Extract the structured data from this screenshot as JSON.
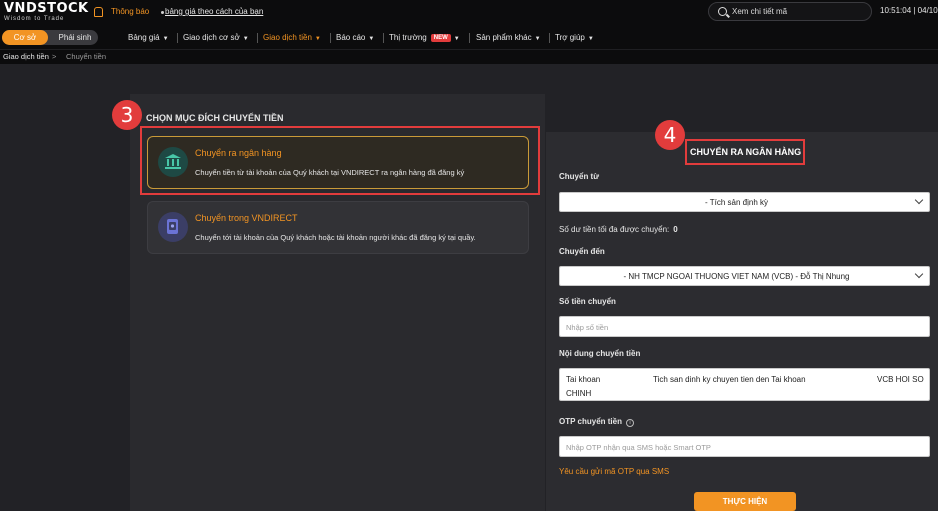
{
  "topbar": {
    "logo_main": "VNDSTOCK",
    "logo_sub": "Wisdom to Trade",
    "notification_label": "Thông báo",
    "ticker_text": "bảng giá theo cách của bạn",
    "search_placeholder": "Xem chi tiết mã",
    "clock": "10:51:04 | 04/10"
  },
  "market_switch": {
    "primary": "Cơ sở",
    "secondary": "Phái sinh"
  },
  "nav": {
    "items": [
      {
        "label": "Bảng giá",
        "active": false
      },
      {
        "label": "Giao dịch cơ sở",
        "active": false
      },
      {
        "label": "Giao dịch tiền",
        "active": true
      },
      {
        "label": "Báo cáo",
        "active": false
      },
      {
        "label": "Thị trường",
        "active": false,
        "badge": "NEW"
      },
      {
        "label": "Sản phẩm khác",
        "active": false
      },
      {
        "label": "Trợ giúp",
        "active": false
      }
    ]
  },
  "breadcrumb": {
    "root": "Giao dịch tiền",
    "separator": ">",
    "current": "Chuyển tiền"
  },
  "annotations": {
    "step_left": "3",
    "step_right": "4",
    "color": "#e23c3c"
  },
  "purpose": {
    "title": "CHỌN MỤC ĐÍCH CHUYỂN TIỀN",
    "options": [
      {
        "title": "Chuyển ra ngân hàng",
        "description": "Chuyển tiền từ tài khoản của Quý khách tại VNDIRECT ra ngân hàng đã đăng ký",
        "icon": "bank-icon",
        "selected": true
      },
      {
        "title": "Chuyển trong VNDIRECT",
        "description": "Chuyển tới tài khoản của Quý khách hoặc tài khoản người khác đã đăng ký tại quầy.",
        "icon": "transfer-card-icon",
        "selected": false
      }
    ]
  },
  "form": {
    "title": "CHUYỂN RA NGÂN HÀNG",
    "from_label": "Chuyển từ",
    "from_value": "- Tích sản định kỳ",
    "max_label": "Số dư tiền tối đa được chuyển:",
    "max_value": "0",
    "to_label": "Chuyển đến",
    "to_value": "- NH TMCP NGOAI THUONG VIET NAM (VCB) - Đỗ Thị Nhung",
    "amount_label": "Số tiền chuyển",
    "amount_placeholder": "Nhập số tiền",
    "content_label": "Nội dung chuyển tiền",
    "content_parts": [
      "Tai khoan",
      "Tich san dinh ky chuyen tien den Tai khoan",
      "VCB HOI SO",
      "CHINH"
    ],
    "otp_label": "OTP chuyển tiền",
    "otp_info_icon": "i",
    "otp_placeholder": "Nhập OTP nhận qua SMS hoặc Smart OTP",
    "otp_request": "Yêu cầu gửi mã OTP qua SMS",
    "submit": "THỰC HIỆN"
  },
  "colors": {
    "accent": "#f29423",
    "background": "#1c1c1f",
    "panel": "#2a2a2e"
  }
}
